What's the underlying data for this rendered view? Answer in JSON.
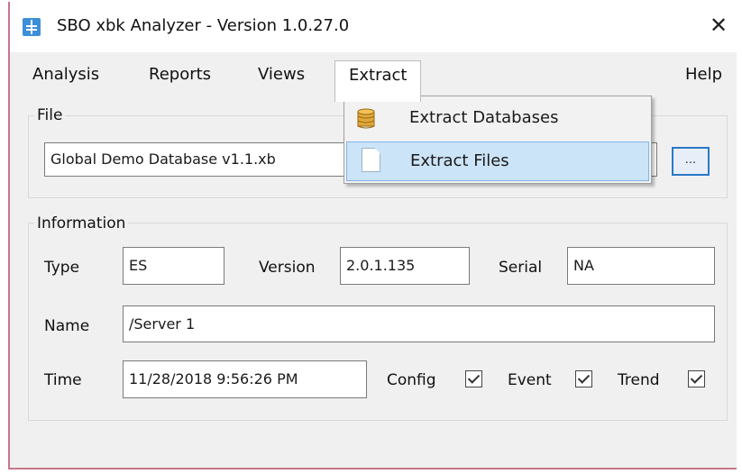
{
  "window": {
    "title": "SBO xbk Analyzer - Version 1.0.27.0",
    "close_glyph": "✕",
    "icon": "app-icon"
  },
  "menu": {
    "analysis": "Analysis",
    "reports": "Reports",
    "views": "Views",
    "extract": "Extract",
    "help": "Help"
  },
  "extract_menu": {
    "items": [
      {
        "label": "Extract Databases",
        "icon": "database-icon"
      },
      {
        "label": "Extract Files",
        "icon": "file-icon"
      }
    ]
  },
  "file_group": {
    "title": "File",
    "path_value": "Global Demo Database v1.1.xb",
    "browse_label": "..."
  },
  "info_group": {
    "title": "Information",
    "type_label": "Type",
    "type_value": "ES",
    "version_label": "Version",
    "version_value": "2.0.1.135",
    "serial_label": "Serial",
    "serial_value": "NA",
    "name_label": "Name",
    "name_value": "/Server 1",
    "time_label": "Time",
    "time_value": "11/28/2018 9:56:26 PM",
    "config_label": "Config",
    "config_checked": true,
    "event_label": "Event",
    "event_checked": true,
    "trend_label": "Trend",
    "trend_checked": true
  },
  "colors": {
    "accent": "#3c8fd8",
    "menu_hover": "#cce4f7",
    "window_border": "#c8758a"
  }
}
